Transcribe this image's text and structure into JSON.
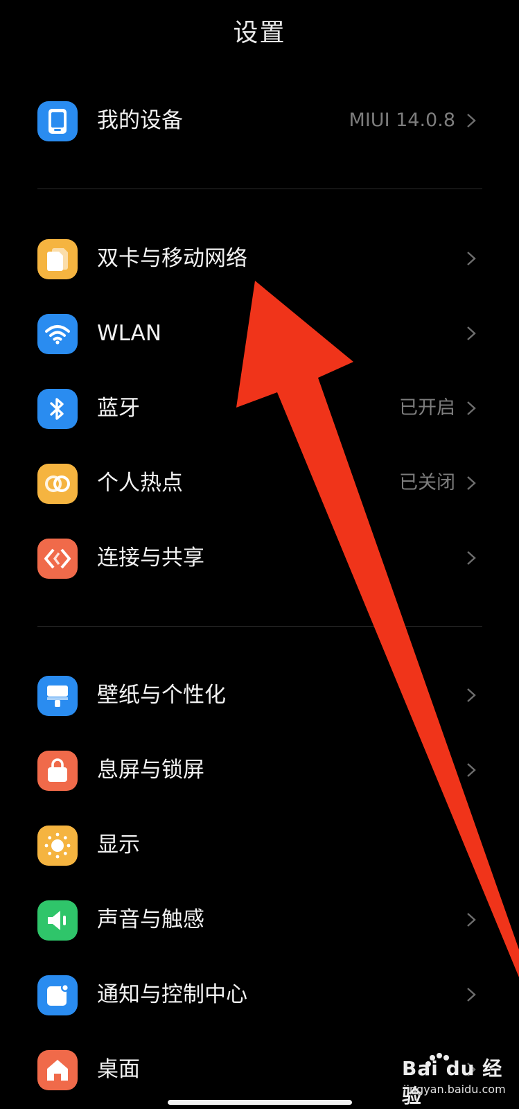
{
  "header": {
    "title": "设置"
  },
  "sections": [
    {
      "items": [
        {
          "id": "device",
          "label": "我的设备",
          "value": "MIUI 14.0.8",
          "icon": "phone-icon",
          "color": "#2a8cf0"
        }
      ]
    },
    {
      "items": [
        {
          "id": "sim",
          "label": "双卡与移动网络",
          "value": "",
          "icon": "sim-card-icon",
          "color": "#f5b440"
        },
        {
          "id": "wlan",
          "label": "WLAN",
          "value": "",
          "icon": "wifi-icon",
          "color": "#2a8cf0"
        },
        {
          "id": "bluetooth",
          "label": "蓝牙",
          "value": "已开启",
          "icon": "bluetooth-icon",
          "color": "#2a8cf0"
        },
        {
          "id": "hotspot",
          "label": "个人热点",
          "value": "已关闭",
          "icon": "hotspot-icon",
          "color": "#f5b440"
        },
        {
          "id": "connect",
          "label": "连接与共享",
          "value": "",
          "icon": "share-connect-icon",
          "color": "#f06a4a"
        }
      ]
    },
    {
      "items": [
        {
          "id": "wallpaper",
          "label": "壁纸与个性化",
          "value": "",
          "icon": "paint-brush-icon",
          "color": "#2a8cf0"
        },
        {
          "id": "lockscreen",
          "label": "息屏与锁屏",
          "value": "",
          "icon": "lock-icon",
          "color": "#f06a4a"
        },
        {
          "id": "display",
          "label": "显示",
          "value": "",
          "icon": "sun-icon",
          "color": "#f5b440"
        },
        {
          "id": "sound",
          "label": "声音与触感",
          "value": "",
          "icon": "speaker-icon",
          "color": "#2fc56a"
        },
        {
          "id": "notify",
          "label": "通知与控制中心",
          "value": "",
          "icon": "notification-icon",
          "color": "#2a8cf0"
        },
        {
          "id": "desktop",
          "label": "桌面",
          "value": "",
          "icon": "home-icon",
          "color": "#f06a4a"
        }
      ]
    }
  ],
  "annotation": {
    "arrow_color": "#f0341a",
    "icon": "red-arrow-annotation"
  },
  "watermark": {
    "brand": "Bai du 经验",
    "url": "jingyan.baidu.com"
  }
}
